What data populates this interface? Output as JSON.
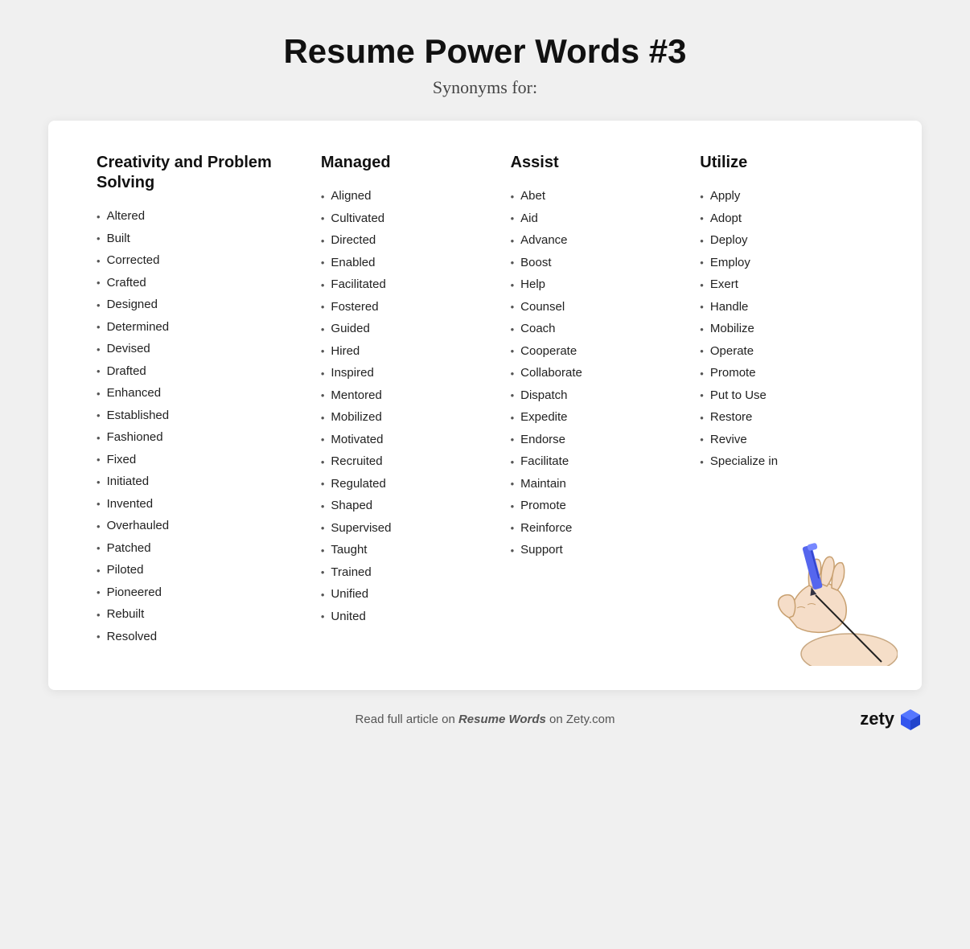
{
  "header": {
    "title": "Resume Power Words #3",
    "subtitle": "Synonyms for:"
  },
  "columns": [
    {
      "header": "Creativity and Problem Solving",
      "items": [
        "Altered",
        "Built",
        "Corrected",
        "Crafted",
        "Designed",
        "Determined",
        "Devised",
        "Drafted",
        "Enhanced",
        "Established",
        "Fashioned",
        "Fixed",
        "Initiated",
        "Invented",
        "Overhauled",
        "Patched",
        "Piloted",
        "Pioneered",
        "Rebuilt",
        "Resolved"
      ]
    },
    {
      "header": "Managed",
      "items": [
        "Aligned",
        "Cultivated",
        "Directed",
        "Enabled",
        "Facilitated",
        "Fostered",
        "Guided",
        "Hired",
        "Inspired",
        "Mentored",
        "Mobilized",
        "Motivated",
        "Recruited",
        "Regulated",
        "Shaped",
        "Supervised",
        "Taught",
        "Trained",
        "Unified",
        "United"
      ]
    },
    {
      "header": "Assist",
      "items": [
        "Abet",
        "Aid",
        "Advance",
        "Boost",
        "Help",
        "Counsel",
        "Coach",
        "Cooperate",
        "Collaborate",
        "Dispatch",
        "Expedite",
        "Endorse",
        "Facilitate",
        "Maintain",
        "Promote",
        "Reinforce",
        "Support"
      ]
    },
    {
      "header": "Utilize",
      "items": [
        "Apply",
        "Adopt",
        "Deploy",
        "Employ",
        "Exert",
        "Handle",
        "Mobilize",
        "Operate",
        "Promote",
        "Put to Use",
        "Restore",
        "Revive",
        "Specialize in"
      ]
    }
  ],
  "footer": {
    "text": "Read full article on ",
    "link_text": "Resume Words",
    "text_after": " on Zety.com"
  },
  "brand": {
    "name": "zety",
    "accent_color": "#3355dd"
  }
}
